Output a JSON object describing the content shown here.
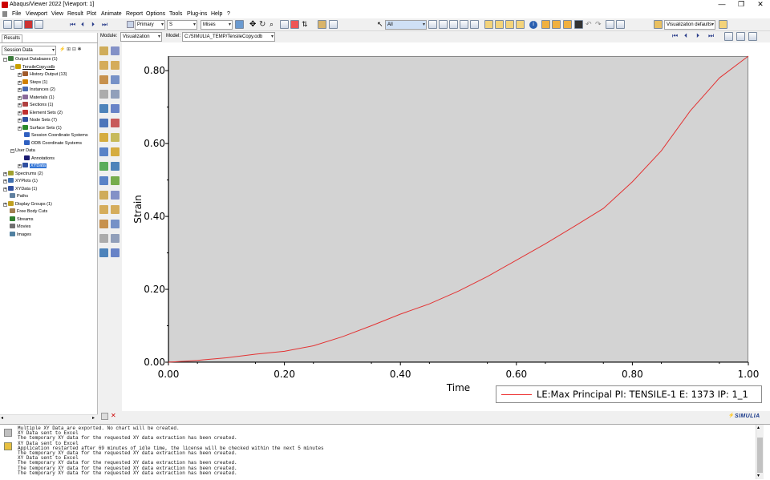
{
  "window": {
    "title": "Abaqus/Viewer 2022 [Viewport: 1]",
    "controls": [
      "—",
      "❐",
      "✕"
    ]
  },
  "menu": [
    "File",
    "Viewport",
    "View",
    "Result",
    "Plot",
    "Animate",
    "Report",
    "Options",
    "Tools",
    "Plug-ins",
    "Help",
    "?"
  ],
  "toolbar": {
    "step_primary": "Primary",
    "step_component": "S",
    "invariant": "Mises",
    "selection_filter": "All",
    "view_defaults": "Visualization defaults"
  },
  "context": {
    "module_label": "Module:",
    "module_value": "Visualization",
    "model_label": "Model:",
    "model_value": "C:/SIMULIA_TEMP/TensileCopy.odb"
  },
  "left_panel": {
    "tab": "Results",
    "dropdown": "Session Data",
    "tree": [
      {
        "label": "Output Databases (1)",
        "depth": 0,
        "pm": "-",
        "color": "#3b7a3b"
      },
      {
        "label": "TensileCopy.odb",
        "depth": 1,
        "pm": "-",
        "color": "#c8a000",
        "underline": true
      },
      {
        "label": "History Output (13)",
        "depth": 2,
        "pm": "+",
        "color": "#a05a2a"
      },
      {
        "label": "Steps (1)",
        "depth": 2,
        "pm": "+",
        "color": "#d08000"
      },
      {
        "label": "Instances (2)",
        "depth": 2,
        "pm": "+",
        "color": "#4a6ab0"
      },
      {
        "label": "Materials (1)",
        "depth": 2,
        "pm": "+",
        "color": "#8a6a9a"
      },
      {
        "label": "Sections (1)",
        "depth": 2,
        "pm": "+",
        "color": "#b04040"
      },
      {
        "label": "Element Sets (2)",
        "depth": 2,
        "pm": "+",
        "color": "#c03030"
      },
      {
        "label": "Node Sets (7)",
        "depth": 2,
        "pm": "+",
        "color": "#3050a0"
      },
      {
        "label": "Surface Sets (1)",
        "depth": 2,
        "pm": "+",
        "color": "#2a8a2a"
      },
      {
        "label": "Session Coordinate Systems",
        "depth": 2,
        "pm": "",
        "color": "#3060c0"
      },
      {
        "label": "ODB Coordinate Systems",
        "depth": 2,
        "pm": "",
        "color": "#3060c0"
      },
      {
        "label": "User Data",
        "depth": 1,
        "pm": "-",
        "color": ""
      },
      {
        "label": "Annotations",
        "depth": 2,
        "pm": "",
        "color": "#1a1a70"
      },
      {
        "label": "XYData",
        "depth": 2,
        "pm": "+",
        "color": "#3050a0",
        "selected": true
      },
      {
        "label": "Spectrums (2)",
        "depth": 0,
        "pm": "+",
        "color": "#a0a030"
      },
      {
        "label": "XYPlots (1)",
        "depth": 0,
        "pm": "+",
        "color": "#4070b0"
      },
      {
        "label": "XYData (1)",
        "depth": 0,
        "pm": "+",
        "color": "#3050a0"
      },
      {
        "label": "Paths",
        "depth": 0,
        "pm": "",
        "color": "#6080a0"
      },
      {
        "label": "Display Groups (1)",
        "depth": 0,
        "pm": "+",
        "color": "#c0a020"
      },
      {
        "label": "Free Body Cuts",
        "depth": 0,
        "pm": "",
        "color": "#a08050"
      },
      {
        "label": "Streams",
        "depth": 0,
        "pm": "",
        "color": "#308030"
      },
      {
        "label": "Movies",
        "depth": 0,
        "pm": "",
        "color": "#707070"
      },
      {
        "label": "Images",
        "depth": 0,
        "pm": "",
        "color": "#5080a0"
      }
    ]
  },
  "chart_data": {
    "type": "line",
    "xlabel": "Time",
    "ylabel": "Strain",
    "xlim": [
      0,
      1.0
    ],
    "ylim": [
      0,
      0.84
    ],
    "x_ticks": [
      "0.00",
      "0.20",
      "0.40",
      "0.60",
      "0.80",
      "1.00"
    ],
    "y_ticks": [
      "0.00",
      "0.20",
      "0.40",
      "0.60",
      "0.80"
    ],
    "series": [
      {
        "name": "LE:Max Principal PI: TENSILE-1 E: 1373 IP: 1_1",
        "color": "#e33333",
        "x": [
          0.0,
          0.05,
          0.1,
          0.15,
          0.2,
          0.25,
          0.3,
          0.35,
          0.4,
          0.45,
          0.5,
          0.55,
          0.6,
          0.65,
          0.7,
          0.75,
          0.8,
          0.85,
          0.9,
          0.95,
          1.0
        ],
        "y": [
          0.0,
          0.005,
          0.012,
          0.022,
          0.03,
          0.045,
          0.07,
          0.1,
          0.132,
          0.16,
          0.195,
          0.235,
          0.28,
          0.325,
          0.373,
          0.422,
          0.495,
          0.58,
          0.69,
          0.78,
          0.84
        ]
      }
    ]
  },
  "brand": "SIMULIA",
  "messages": [
    "Multiple XY Data are exported.  No chart will be created.",
    "XY Data sent to Excel",
    "The temporary XY data for the requested XY data extraction has been created.",
    "XY Data sent to Excel",
    "Application restarted after 69 minutes of idle time, the license will be checked within the next 5 minutes",
    "The temporary XY data for the requested XY data extraction has been created.",
    "XY Data sent to Excel",
    "The temporary XY data for the requested XY data extraction has been created.",
    "The temporary XY data for the requested XY data extraction has been created.",
    "The temporary XY data for the requested XY data extraction has been created."
  ]
}
